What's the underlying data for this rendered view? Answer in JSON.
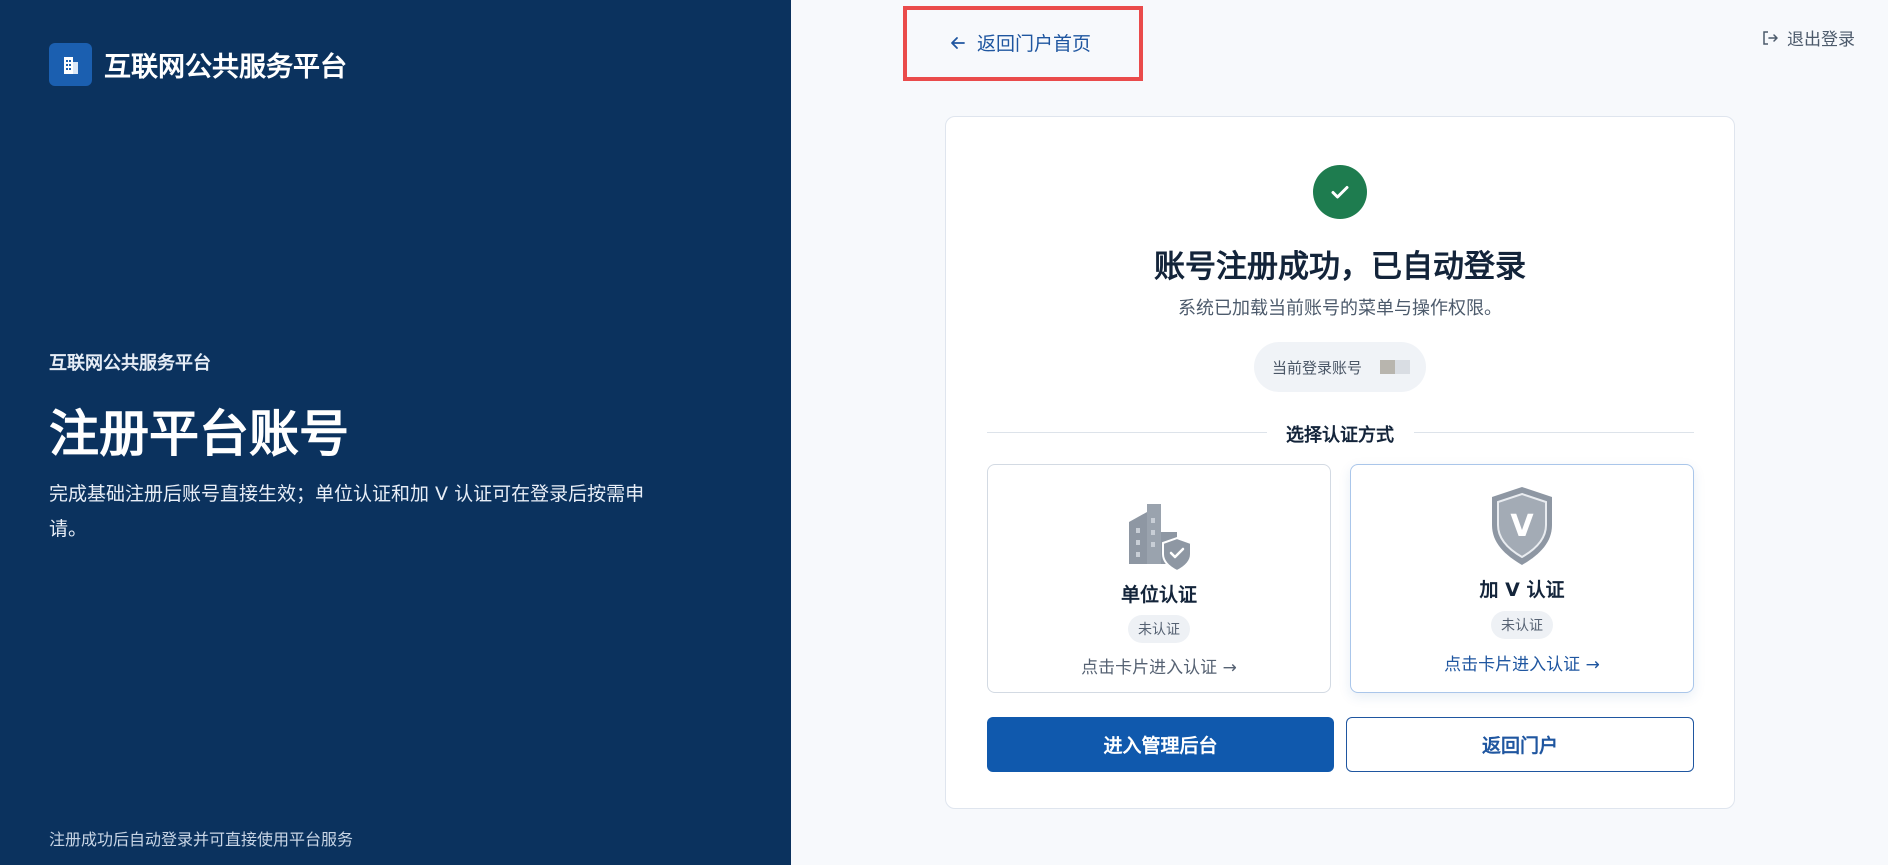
{
  "brand": {
    "name": "互联网公共服务平台"
  },
  "hero": {
    "kicker": "互联网公共服务平台",
    "title": "注册平台账号",
    "description": "完成基础注册后账号直接生效；单位认证和加 V 认证可在登录后按需申请。"
  },
  "left_footer": "注册成功后自动登录并可直接使用平台服务",
  "top": {
    "back_label": "返回门户首页",
    "logout_label": "退出登录"
  },
  "card": {
    "title": "账号注册成功，已自动登录",
    "subtitle": "系统已加载当前账号的菜单与操作权限。",
    "account_label": "当前登录账号",
    "divider_label": "选择认证方式",
    "auth_cards": [
      {
        "title": "单位认证",
        "status": "未认证",
        "action": "点击卡片进入认证",
        "icon": "building-shield-icon"
      },
      {
        "title": "加 V 认证",
        "status": "未认证",
        "action": "点击卡片进入认证",
        "icon": "v-shield-icon"
      }
    ],
    "primary_button": "进入管理后台",
    "secondary_button": "返回门户"
  },
  "colors": {
    "left_panel": "#0b325e",
    "primary": "#1059ad",
    "success": "#1e7c4f",
    "highlight_box": "#ea4b4b"
  }
}
